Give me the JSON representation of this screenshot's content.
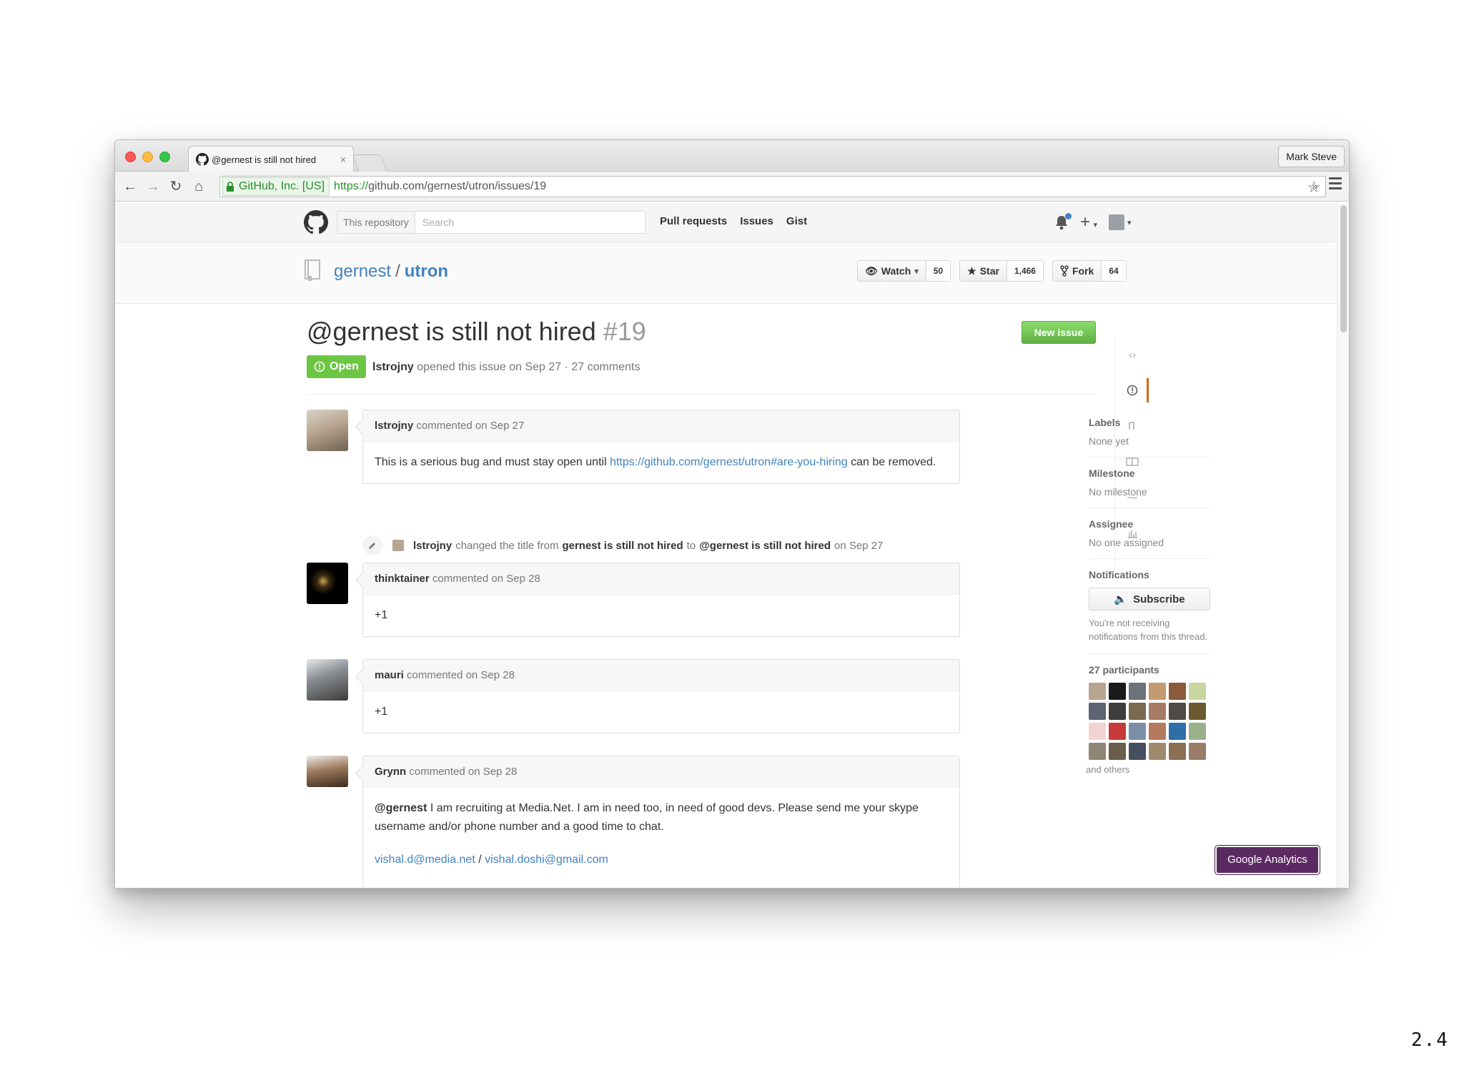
{
  "browser": {
    "tab_title": "@gernest is still not hired",
    "tab_close": "×",
    "profile_name": "Mark Steve",
    "ev_label": "GitHub, Inc. [US]",
    "url_scheme": "https://",
    "url_rest": "github.com/gernest/utron/issues/19",
    "extensions_more": "»",
    "colors": {
      "close": "#fc5753",
      "minimize": "#fdbc40",
      "zoom": "#33c748",
      "ev_green": "#2a8f2a"
    }
  },
  "header": {
    "search_scope": "This repository",
    "search_placeholder": "Search",
    "nav": [
      "Pull requests",
      "Issues",
      "Gist"
    ],
    "icons": [
      "github-logo-icon",
      "bell-icon",
      "plus-icon",
      "avatar"
    ]
  },
  "repo": {
    "owner": "gernest",
    "separator": "/",
    "name": "utron",
    "watch_label": "Watch",
    "watch_count": "50",
    "star_label": "Star",
    "star_count": "1,466",
    "fork_label": "Fork",
    "fork_count": "64"
  },
  "issue": {
    "title": "@gernest is still not hired",
    "number": "#19",
    "state": "Open",
    "author": "lstrojny",
    "meta_rest": "opened this issue on Sep 27 · 27 comments",
    "new_issue_label": "New issue",
    "colors": {
      "open": "#6cc644",
      "new_issue": "#60b044",
      "link": "#4183c4",
      "selected_nav": "#d26911"
    }
  },
  "comments": [
    {
      "author": "lstrojny",
      "action": "commented on Sep 27",
      "body_before": "This is a serious bug and must stay open until ",
      "body_link": "https://github.com/gernest/utron#are-you-hiring",
      "body_after": " can be removed."
    },
    {
      "author": "thinktainer",
      "action": "commented on Sep 28",
      "body": "+1"
    },
    {
      "author": "mauri",
      "action": "commented on Sep 28",
      "body": "+1"
    },
    {
      "author": "Grynn",
      "action": "commented on Sep 28",
      "mention": "@gernest",
      "body": " I am recruiting at Media.Net. I am in need too, in need of good devs. Please send me your skype username and/or phone number and a good time to chat.",
      "email1": "vishal.d@media.net",
      "email_sep": " / ",
      "email2": "vishal.doshi@gmail.com"
    }
  ],
  "event": {
    "actor": "lstrojny",
    "text1": "changed the title from",
    "old_title": "gernest is still not hired",
    "text2": "to",
    "new_title": "@gernest is still not hired",
    "date": "on Sep 27"
  },
  "sidebar": {
    "labels_heading": "Labels",
    "labels_value": "None yet",
    "milestone_heading": "Milestone",
    "milestone_value": "No milestone",
    "assignee_heading": "Assignee",
    "assignee_value": "No one assigned",
    "notifications_heading": "Notifications",
    "subscribe_label": "Subscribe",
    "notifications_note": "You're not receiving notifications from this thread.",
    "participants_heading": "27 participants",
    "and_others": "and others"
  },
  "overlay": {
    "ga_button": "Google Analytics",
    "page_number": "2.4"
  }
}
